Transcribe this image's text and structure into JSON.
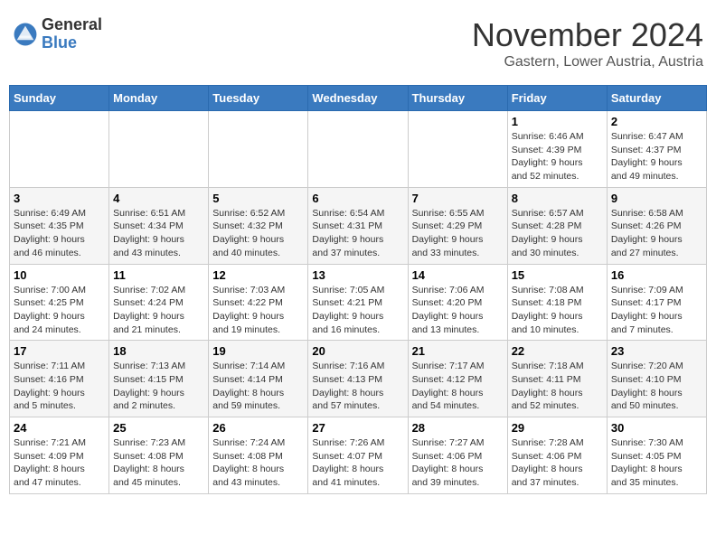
{
  "logo": {
    "general": "General",
    "blue": "Blue"
  },
  "header": {
    "month": "November 2024",
    "location": "Gastern, Lower Austria, Austria"
  },
  "weekdays": [
    "Sunday",
    "Monday",
    "Tuesday",
    "Wednesday",
    "Thursday",
    "Friday",
    "Saturday"
  ],
  "weeks": [
    [
      {
        "day": "",
        "info": ""
      },
      {
        "day": "",
        "info": ""
      },
      {
        "day": "",
        "info": ""
      },
      {
        "day": "",
        "info": ""
      },
      {
        "day": "",
        "info": ""
      },
      {
        "day": "1",
        "info": "Sunrise: 6:46 AM\nSunset: 4:39 PM\nDaylight: 9 hours\nand 52 minutes."
      },
      {
        "day": "2",
        "info": "Sunrise: 6:47 AM\nSunset: 4:37 PM\nDaylight: 9 hours\nand 49 minutes."
      }
    ],
    [
      {
        "day": "3",
        "info": "Sunrise: 6:49 AM\nSunset: 4:35 PM\nDaylight: 9 hours\nand 46 minutes."
      },
      {
        "day": "4",
        "info": "Sunrise: 6:51 AM\nSunset: 4:34 PM\nDaylight: 9 hours\nand 43 minutes."
      },
      {
        "day": "5",
        "info": "Sunrise: 6:52 AM\nSunset: 4:32 PM\nDaylight: 9 hours\nand 40 minutes."
      },
      {
        "day": "6",
        "info": "Sunrise: 6:54 AM\nSunset: 4:31 PM\nDaylight: 9 hours\nand 37 minutes."
      },
      {
        "day": "7",
        "info": "Sunrise: 6:55 AM\nSunset: 4:29 PM\nDaylight: 9 hours\nand 33 minutes."
      },
      {
        "day": "8",
        "info": "Sunrise: 6:57 AM\nSunset: 4:28 PM\nDaylight: 9 hours\nand 30 minutes."
      },
      {
        "day": "9",
        "info": "Sunrise: 6:58 AM\nSunset: 4:26 PM\nDaylight: 9 hours\nand 27 minutes."
      }
    ],
    [
      {
        "day": "10",
        "info": "Sunrise: 7:00 AM\nSunset: 4:25 PM\nDaylight: 9 hours\nand 24 minutes."
      },
      {
        "day": "11",
        "info": "Sunrise: 7:02 AM\nSunset: 4:24 PM\nDaylight: 9 hours\nand 21 minutes."
      },
      {
        "day": "12",
        "info": "Sunrise: 7:03 AM\nSunset: 4:22 PM\nDaylight: 9 hours\nand 19 minutes."
      },
      {
        "day": "13",
        "info": "Sunrise: 7:05 AM\nSunset: 4:21 PM\nDaylight: 9 hours\nand 16 minutes."
      },
      {
        "day": "14",
        "info": "Sunrise: 7:06 AM\nSunset: 4:20 PM\nDaylight: 9 hours\nand 13 minutes."
      },
      {
        "day": "15",
        "info": "Sunrise: 7:08 AM\nSunset: 4:18 PM\nDaylight: 9 hours\nand 10 minutes."
      },
      {
        "day": "16",
        "info": "Sunrise: 7:09 AM\nSunset: 4:17 PM\nDaylight: 9 hours\nand 7 minutes."
      }
    ],
    [
      {
        "day": "17",
        "info": "Sunrise: 7:11 AM\nSunset: 4:16 PM\nDaylight: 9 hours\nand 5 minutes."
      },
      {
        "day": "18",
        "info": "Sunrise: 7:13 AM\nSunset: 4:15 PM\nDaylight: 9 hours\nand 2 minutes."
      },
      {
        "day": "19",
        "info": "Sunrise: 7:14 AM\nSunset: 4:14 PM\nDaylight: 8 hours\nand 59 minutes."
      },
      {
        "day": "20",
        "info": "Sunrise: 7:16 AM\nSunset: 4:13 PM\nDaylight: 8 hours\nand 57 minutes."
      },
      {
        "day": "21",
        "info": "Sunrise: 7:17 AM\nSunset: 4:12 PM\nDaylight: 8 hours\nand 54 minutes."
      },
      {
        "day": "22",
        "info": "Sunrise: 7:18 AM\nSunset: 4:11 PM\nDaylight: 8 hours\nand 52 minutes."
      },
      {
        "day": "23",
        "info": "Sunrise: 7:20 AM\nSunset: 4:10 PM\nDaylight: 8 hours\nand 50 minutes."
      }
    ],
    [
      {
        "day": "24",
        "info": "Sunrise: 7:21 AM\nSunset: 4:09 PM\nDaylight: 8 hours\nand 47 minutes."
      },
      {
        "day": "25",
        "info": "Sunrise: 7:23 AM\nSunset: 4:08 PM\nDaylight: 8 hours\nand 45 minutes."
      },
      {
        "day": "26",
        "info": "Sunrise: 7:24 AM\nSunset: 4:08 PM\nDaylight: 8 hours\nand 43 minutes."
      },
      {
        "day": "27",
        "info": "Sunrise: 7:26 AM\nSunset: 4:07 PM\nDaylight: 8 hours\nand 41 minutes."
      },
      {
        "day": "28",
        "info": "Sunrise: 7:27 AM\nSunset: 4:06 PM\nDaylight: 8 hours\nand 39 minutes."
      },
      {
        "day": "29",
        "info": "Sunrise: 7:28 AM\nSunset: 4:06 PM\nDaylight: 8 hours\nand 37 minutes."
      },
      {
        "day": "30",
        "info": "Sunrise: 7:30 AM\nSunset: 4:05 PM\nDaylight: 8 hours\nand 35 minutes."
      }
    ]
  ]
}
